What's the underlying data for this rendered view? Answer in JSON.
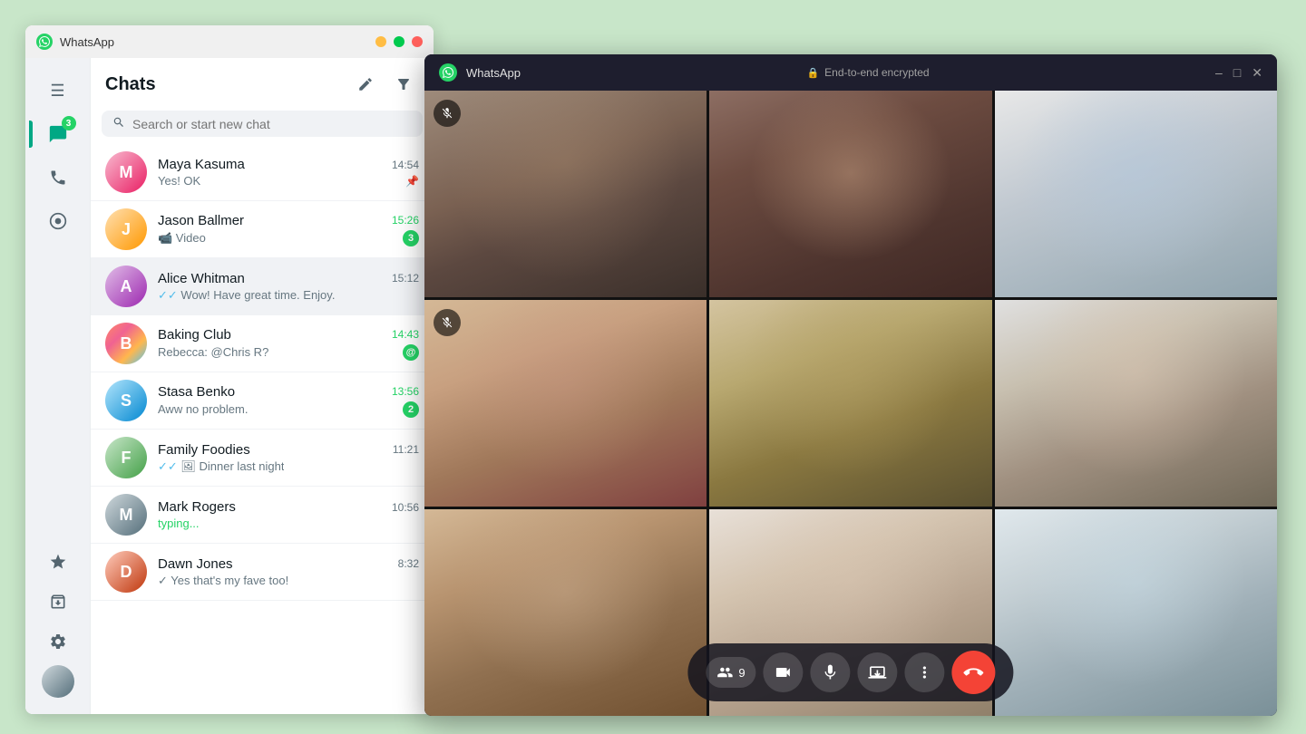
{
  "app": {
    "title": "WhatsApp"
  },
  "titlebar": {
    "min": "–",
    "max": "□",
    "close": "✕"
  },
  "sidebar": {
    "badge_count": "3",
    "icons": [
      {
        "name": "menu-icon",
        "symbol": "☰",
        "active": false
      },
      {
        "name": "chats-icon",
        "symbol": "💬",
        "active": true,
        "badge": "3"
      },
      {
        "name": "calls-icon",
        "symbol": "📞",
        "active": false
      },
      {
        "name": "status-icon",
        "symbol": "⊙",
        "active": false
      },
      {
        "name": "starred-icon",
        "symbol": "★",
        "active": false
      },
      {
        "name": "archived-icon",
        "symbol": "🗂",
        "active": false
      },
      {
        "name": "settings-icon",
        "symbol": "⚙",
        "active": false
      }
    ]
  },
  "chats": {
    "title": "Chats",
    "new_chat_label": "New Chat",
    "filter_label": "Filter",
    "search_placeholder": "Search or start new chat",
    "items": [
      {
        "id": 1,
        "name": "Maya Kasuma",
        "preview": "Yes! OK",
        "time": "14:54",
        "unread": 0,
        "pinned": true,
        "avatar_class": "av-maya",
        "initials": "M"
      },
      {
        "id": 2,
        "name": "Jason Ballmer",
        "preview": "📹 Video",
        "time": "15:26",
        "unread": 3,
        "avatar_class": "av-jason",
        "initials": "J"
      },
      {
        "id": 3,
        "name": "Alice Whitman",
        "preview": "Wow! Have great time. Enjoy.",
        "time": "15:12",
        "unread": 0,
        "active": true,
        "avatar_class": "av-alice",
        "initials": "A",
        "double_check": true
      },
      {
        "id": 4,
        "name": "Baking Club",
        "preview": "Rebecca: @Chris R?",
        "time": "14:43",
        "unread": 1,
        "mention": true,
        "avatar_class": "av-baking",
        "initials": "B"
      },
      {
        "id": 5,
        "name": "Stasa Benko",
        "preview": "Aww no problem.",
        "time": "13:56",
        "unread": 2,
        "avatar_class": "av-stasa",
        "initials": "S"
      },
      {
        "id": 6,
        "name": "Family Foodies",
        "preview": "✓✓ 🖼 Dinner last night",
        "time": "11:21",
        "unread": 0,
        "avatar_class": "av-family",
        "initials": "F"
      },
      {
        "id": 7,
        "name": "Mark Rogers",
        "preview": "typing...",
        "time": "10:56",
        "typing": true,
        "unread": 0,
        "avatar_class": "av-mark",
        "initials": "M"
      },
      {
        "id": 8,
        "name": "Dawn Jones",
        "preview": "✓ Yes that's my fave too!",
        "time": "8:32",
        "unread": 0,
        "avatar_class": "av-dawn",
        "initials": "D"
      }
    ]
  },
  "video_call": {
    "title": "WhatsApp",
    "encryption_label": "End-to-end encrypted",
    "participants_count": "9",
    "controls": {
      "participants_label": "9",
      "video_label": "Video",
      "mic_label": "Mic",
      "screen_label": "Screen",
      "more_label": "More",
      "end_call_label": "End"
    },
    "participants": [
      {
        "id": 1,
        "muted": true,
        "active_speaker": false
      },
      {
        "id": 2,
        "muted": false,
        "active_speaker": false
      },
      {
        "id": 3,
        "muted": false,
        "active_speaker": false
      },
      {
        "id": 4,
        "muted": true,
        "active_speaker": false
      },
      {
        "id": 5,
        "muted": false,
        "active_speaker": true
      },
      {
        "id": 6,
        "muted": false,
        "active_speaker": false
      },
      {
        "id": 7,
        "muted": false,
        "active_speaker": false
      },
      {
        "id": 8,
        "muted": false,
        "active_speaker": false
      },
      {
        "id": 9,
        "muted": false,
        "active_speaker": false
      }
    ]
  }
}
